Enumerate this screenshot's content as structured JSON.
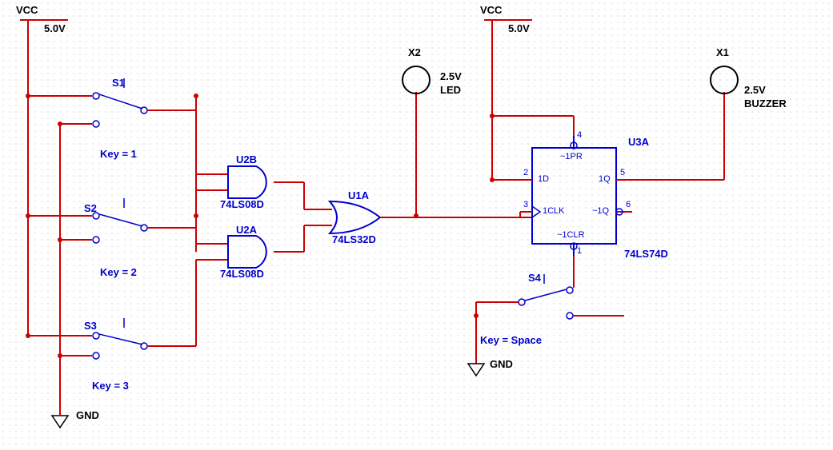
{
  "power": {
    "vcc_left": {
      "name": "VCC",
      "value": "5.0V"
    },
    "vcc_right": {
      "name": "VCC",
      "value": "5.0V"
    },
    "gnd_left": "GND",
    "gnd_right": "GND"
  },
  "switches": {
    "s1": {
      "ref": "S1",
      "key": "Key = 1"
    },
    "s2": {
      "ref": "S2",
      "key": "Key = 2"
    },
    "s3": {
      "ref": "S3",
      "key": "Key = 3"
    },
    "s4": {
      "ref": "S4",
      "key": "Key = Space"
    }
  },
  "gates": {
    "u2b": {
      "ref": "U2B",
      "part": "74LS08D"
    },
    "u2a": {
      "ref": "U2A",
      "part": "74LS08D"
    },
    "u1a": {
      "ref": "U1A",
      "part": "74LS32D"
    },
    "u3a": {
      "ref": "U3A",
      "part": "74LS74D",
      "pins": {
        "pr": "~1PR",
        "d": "1D",
        "q": "1Q",
        "clk": "1CLK",
        "qn": "~1Q",
        "clr": "~1CLR",
        "n_pr": "4",
        "n_d": "2",
        "n_clk": "3",
        "n_q": "5",
        "n_qn": "6",
        "n_clr": "1"
      }
    }
  },
  "probes": {
    "x2": {
      "ref": "X2",
      "v": "2.5V",
      "type": "LED"
    },
    "x1": {
      "ref": "X1",
      "v": "2.5V",
      "type": "BUZZER"
    }
  },
  "colors": {
    "wire": "#cc0000",
    "gate": "#0000cc",
    "text": "#0000cc",
    "black": "#000000"
  }
}
